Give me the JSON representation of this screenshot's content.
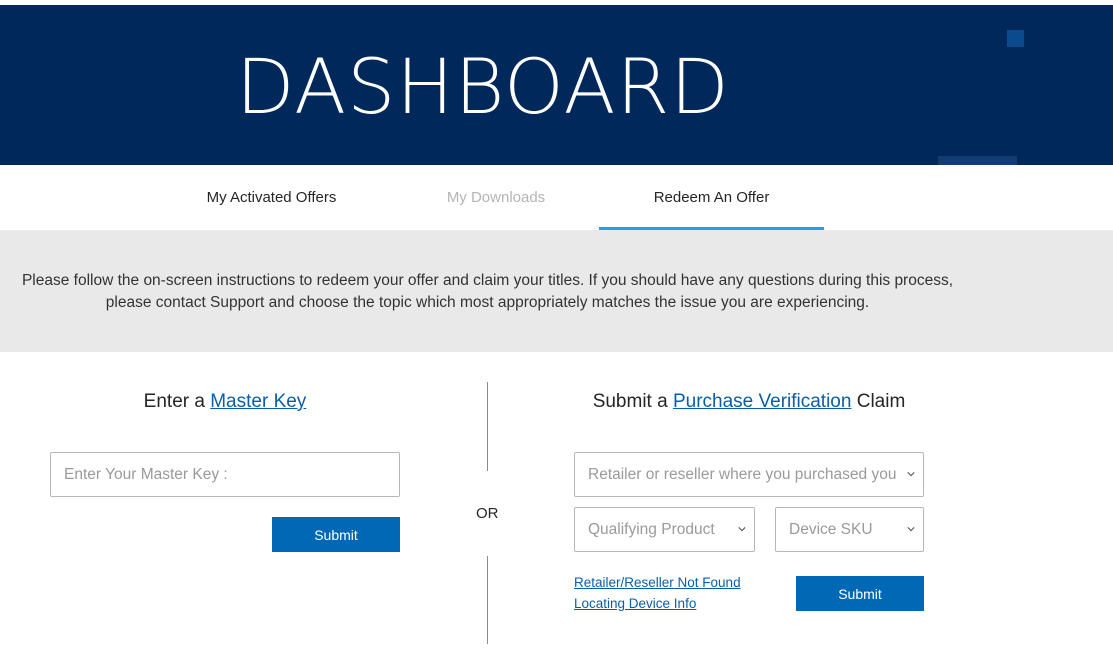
{
  "hero": {
    "title": "DASHBOARD"
  },
  "tabs": [
    {
      "label": "My Activated Offers",
      "state": "normal"
    },
    {
      "label": "My Downloads",
      "state": "disabled"
    },
    {
      "label": "Redeem An Offer",
      "state": "active"
    }
  ],
  "notice": {
    "text": "Please follow the on-screen instructions to redeem your offer and claim your titles. If you should have any questions during this process, please contact Support and choose the topic which most appropriately matches the issue you are experiencing."
  },
  "master_key": {
    "title_prefix": "Enter a ",
    "title_link": "Master Key",
    "input_placeholder": "Enter Your Master Key :",
    "input_value": "",
    "submit_label": "Submit"
  },
  "separator": {
    "label": "OR"
  },
  "purchase_claim": {
    "title_prefix": "Submit a ",
    "title_link": "Purchase Verification",
    "title_suffix": " Claim",
    "retailer_select": "Retailer or reseller where you purchased your",
    "product_select": "Qualifying Product",
    "sku_select": "Device SKU",
    "link_retailer_not_found": "Retailer/Reseller Not Found",
    "link_locating_device": "Locating Device Info",
    "submit_label": "Submit"
  },
  "colors": {
    "hero_bg": "#00285a",
    "tab_active_underline": "#1aa3e8",
    "button_bg": "#0068b5",
    "link": "#0a5ea8",
    "notice_bg": "#e9e9e9"
  }
}
